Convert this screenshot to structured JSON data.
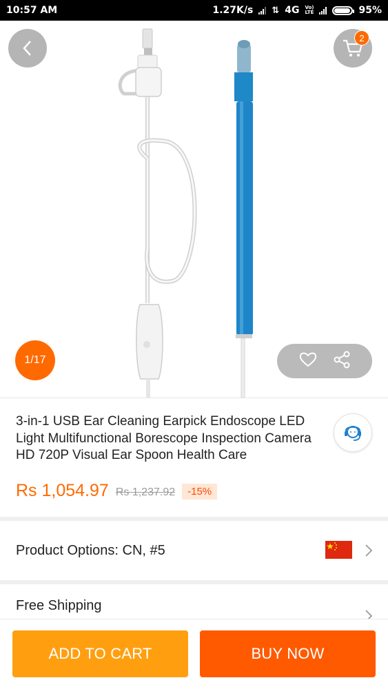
{
  "status_bar": {
    "time": "10:57 AM",
    "speed": "1.27K/s",
    "network": "4G",
    "volte_top": "Vo)",
    "volte_bottom": "LTE",
    "battery": "95%"
  },
  "gallery": {
    "page_indicator": "1/17",
    "cart_count": "2"
  },
  "product": {
    "title": "3-in-1 USB Ear Cleaning Earpick Endoscope LED Light Multifunctional Borescope Inspection Camera HD 720P Visual Ear Spoon Health Care",
    "price": "Rs 1,054.97",
    "original_price": "Rs 1,237.92",
    "discount": "-15%"
  },
  "options": {
    "label": "Product Options: CN, #5"
  },
  "shipping": {
    "label": "Free Shipping"
  },
  "actions": {
    "add_to_cart": "ADD TO CART",
    "buy_now": "BUY NOW"
  },
  "colors": {
    "accent": "#ff6a00",
    "add_to_cart": "#ff9f10",
    "buy_now": "#ff5a00",
    "flag_red": "#de2910",
    "flag_star": "#ffde00",
    "product_blue": "#1e86c8"
  },
  "icons": [
    "back-arrow-icon",
    "shopping-cart-icon",
    "heart-icon",
    "share-icon",
    "customer-support-icon",
    "china-flag-icon",
    "chevron-right-icon"
  ]
}
